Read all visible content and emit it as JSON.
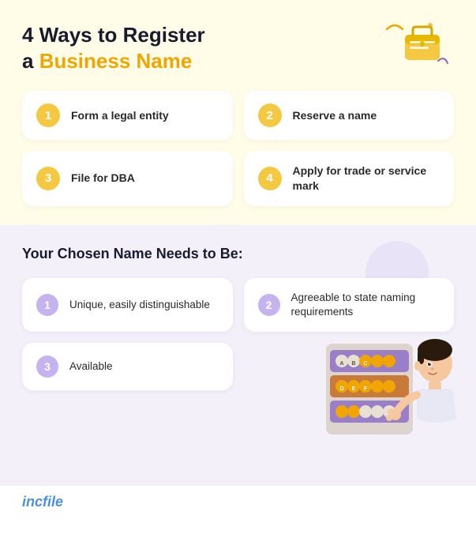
{
  "top": {
    "title_line1": "4 Ways to Register",
    "title_line2_prefix": "a ",
    "title_line2_highlight": "Business Name",
    "cards": [
      {
        "number": "1",
        "text": "Form a legal entity"
      },
      {
        "number": "2",
        "text": "Reserve a name"
      },
      {
        "number": "3",
        "text": "File for DBA"
      },
      {
        "number": "4",
        "text": "Apply for trade or service mark"
      }
    ]
  },
  "bottom": {
    "heading": "Your Chosen Name Needs to Be:",
    "requirements": [
      {
        "number": "1",
        "text": "Unique, easily distinguishable"
      },
      {
        "number": "2",
        "text": "Agreeable to state naming requirements"
      },
      {
        "number": "3",
        "text": "Available"
      }
    ]
  },
  "footer": {
    "logo": "incfile"
  },
  "colors": {
    "yellow_badge": "#f5c842",
    "purple_badge": "#c5b3f0",
    "top_bg": "#fffde7",
    "bottom_bg": "#f3f0fa",
    "highlight": "#f0a500",
    "logo_blue": "#4a90e2"
  }
}
